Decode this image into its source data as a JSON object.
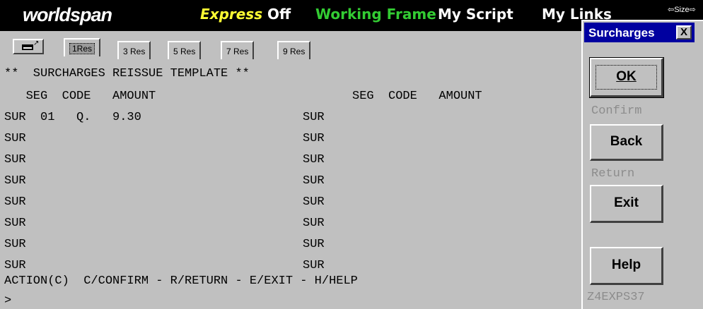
{
  "topbar": {
    "logo": "worldspan",
    "express_label": "Express",
    "express_state": "Off",
    "working_frame": "Working Frame",
    "my_script": "My Script",
    "my_links": "My Links",
    "size_control": "⇦Size⇨"
  },
  "tabs": [
    {
      "label": "1Res"
    },
    {
      "label": "3 Res"
    },
    {
      "label": "5 Res"
    },
    {
      "label": "7 Res"
    },
    {
      "label": "9 Res"
    }
  ],
  "terminal": {
    "header": "**  SURCHARGES REISSUE TEMPLATE **",
    "columns_left": "   SEG  CODE   AMOUNT",
    "columns_right": "SEG  CODE   AMOUNT",
    "rows": [
      {
        "left": "SUR  01   Q.   9.30",
        "right": "SUR"
      },
      {
        "left": "SUR",
        "right": "SUR"
      },
      {
        "left": "SUR",
        "right": "SUR"
      },
      {
        "left": "SUR",
        "right": "SUR"
      },
      {
        "left": "SUR",
        "right": "SUR"
      },
      {
        "left": "SUR",
        "right": "SUR"
      },
      {
        "left": "SUR",
        "right": "SUR"
      },
      {
        "left": "SUR",
        "right": "SUR"
      }
    ],
    "action_line": "ACTION(C)  C/CONFIRM - R/RETURN - E/EXIT - H/HELP",
    "prompt": ">"
  },
  "dialog": {
    "title": "Surcharges",
    "close_label": "X",
    "ok_label": "OK",
    "ok_hint": "Confirm",
    "back_label": "Back",
    "back_hint": "Return",
    "exit_label": "Exit",
    "help_label": "Help",
    "screen_code": "Z4EXPS37"
  }
}
